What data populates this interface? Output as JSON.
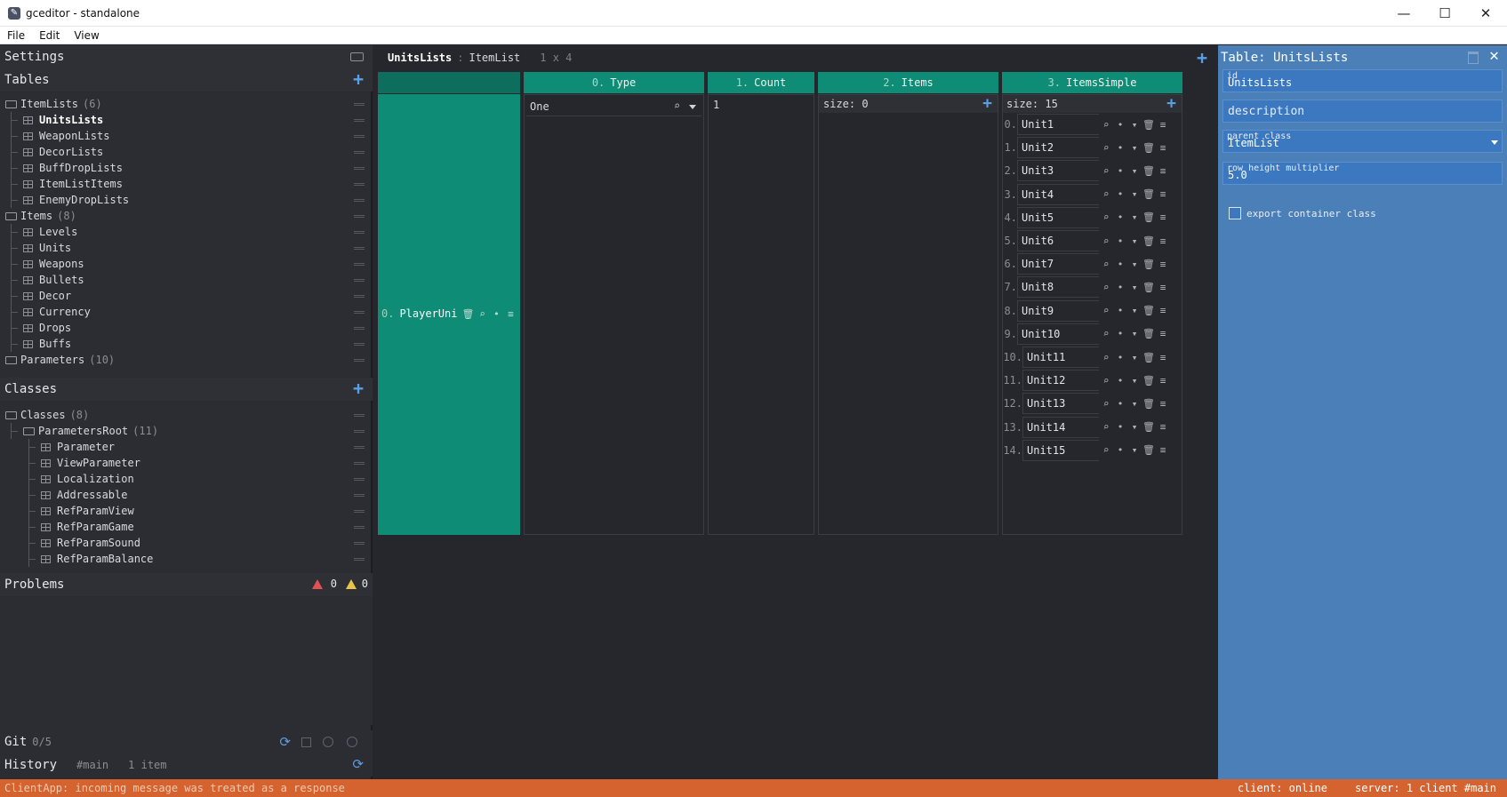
{
  "window": {
    "title": "gceditor - standalone",
    "controls": [
      "—",
      "☐",
      "✕"
    ]
  },
  "menu": [
    "File",
    "Edit",
    "View"
  ],
  "left": {
    "settings_label": "Settings",
    "tables_label": "Tables",
    "tables_tree": [
      {
        "label": "ItemLists",
        "count": "(6)",
        "type": "folder",
        "level": 0
      },
      {
        "label": "UnitsLists",
        "type": "table",
        "level": 1,
        "selected": true
      },
      {
        "label": "WeaponLists",
        "type": "table",
        "level": 1
      },
      {
        "label": "DecorLists",
        "type": "table",
        "level": 1
      },
      {
        "label": "BuffDropLists",
        "type": "table",
        "level": 1
      },
      {
        "label": "ItemListItems",
        "type": "table",
        "level": 1
      },
      {
        "label": "EnemyDropLists",
        "type": "table",
        "level": 1
      },
      {
        "label": "Items",
        "count": "(8)",
        "type": "folder",
        "level": 0
      },
      {
        "label": "Levels",
        "type": "table",
        "level": 1
      },
      {
        "label": "Units",
        "type": "table",
        "level": 1
      },
      {
        "label": "Weapons",
        "type": "table",
        "level": 1
      },
      {
        "label": "Bullets",
        "type": "table",
        "level": 1
      },
      {
        "label": "Decor",
        "type": "table",
        "level": 1
      },
      {
        "label": "Currency",
        "type": "table",
        "level": 1
      },
      {
        "label": "Drops",
        "type": "table",
        "level": 1
      },
      {
        "label": "Buffs",
        "type": "table",
        "level": 1
      },
      {
        "label": "Parameters",
        "count": "(10)",
        "type": "folder",
        "level": 0
      }
    ],
    "classes_label": "Classes",
    "classes_tree": [
      {
        "label": "Classes",
        "count": "(8)",
        "type": "folder",
        "level": 0
      },
      {
        "label": "ParametersRoot",
        "count": "(11)",
        "type": "folder",
        "level": 1
      },
      {
        "label": "Parameter",
        "type": "table",
        "level": 2
      },
      {
        "label": "ViewParameter",
        "type": "table",
        "level": 2
      },
      {
        "label": "Localization",
        "type": "table",
        "level": 2
      },
      {
        "label": "Addressable",
        "type": "table",
        "level": 2
      },
      {
        "label": "RefParamView",
        "type": "table",
        "level": 2
      },
      {
        "label": "RefParamGame",
        "type": "table",
        "level": 2
      },
      {
        "label": "RefParamSound",
        "type": "table",
        "level": 2
      },
      {
        "label": "RefParamBalance",
        "type": "table",
        "level": 2
      }
    ],
    "problems_label": "Problems",
    "errors_count": "0",
    "warnings_count": "0",
    "git_label": "Git",
    "git_count": "0/5",
    "history_label": "History",
    "history_branch": "#main",
    "history_items": "1 item"
  },
  "center": {
    "table_name": "UnitsLists",
    "sep": ":",
    "class_name": "ItemList",
    "dims": "1 x 4",
    "columns": [
      {
        "idx": "0.",
        "name": "Type"
      },
      {
        "idx": "1.",
        "name": "Count"
      },
      {
        "idx": "2.",
        "name": "Items"
      },
      {
        "idx": "3.",
        "name": "ItemsSimple"
      }
    ],
    "row_index": "0.",
    "row_id": "PlayerUni",
    "type_value": "One",
    "count_value": "1",
    "items_size": "size: 0",
    "simple_size": "size: 15",
    "simple_items": [
      {
        "i": "0.",
        "v": "Unit1"
      },
      {
        "i": "1.",
        "v": "Unit2"
      },
      {
        "i": "2.",
        "v": "Unit3"
      },
      {
        "i": "3.",
        "v": "Unit4"
      },
      {
        "i": "4.",
        "v": "Unit5"
      },
      {
        "i": "5.",
        "v": "Unit6"
      },
      {
        "i": "6.",
        "v": "Unit7"
      },
      {
        "i": "7.",
        "v": "Unit8"
      },
      {
        "i": "8.",
        "v": "Unit9"
      },
      {
        "i": "9.",
        "v": "Unit10"
      },
      {
        "i": "10.",
        "v": "Unit11"
      },
      {
        "i": "11.",
        "v": "Unit12"
      },
      {
        "i": "12.",
        "v": "Unit13"
      },
      {
        "i": "13.",
        "v": "Unit14"
      },
      {
        "i": "14.",
        "v": "Unit15"
      }
    ]
  },
  "right": {
    "title": "Table: UnitsLists",
    "id_label": "id",
    "id_value": "UnitsLists",
    "description_placeholder": "description",
    "parent_label": "parent class",
    "parent_value": "ItemList",
    "rowh_label": "row height multiplier",
    "rowh_value": "5.0",
    "export_label": "export container class",
    "export_checked": false
  },
  "status": {
    "message": "ClientApp: incoming message was treated as a response",
    "client": "client: online",
    "server": "server: 1 client #main"
  },
  "colors": {
    "accent_teal": "#0f8c76",
    "accent_blue": "#5a9ee6",
    "right_panel": "#4a7fb7",
    "status_bar": "#d4632f"
  }
}
